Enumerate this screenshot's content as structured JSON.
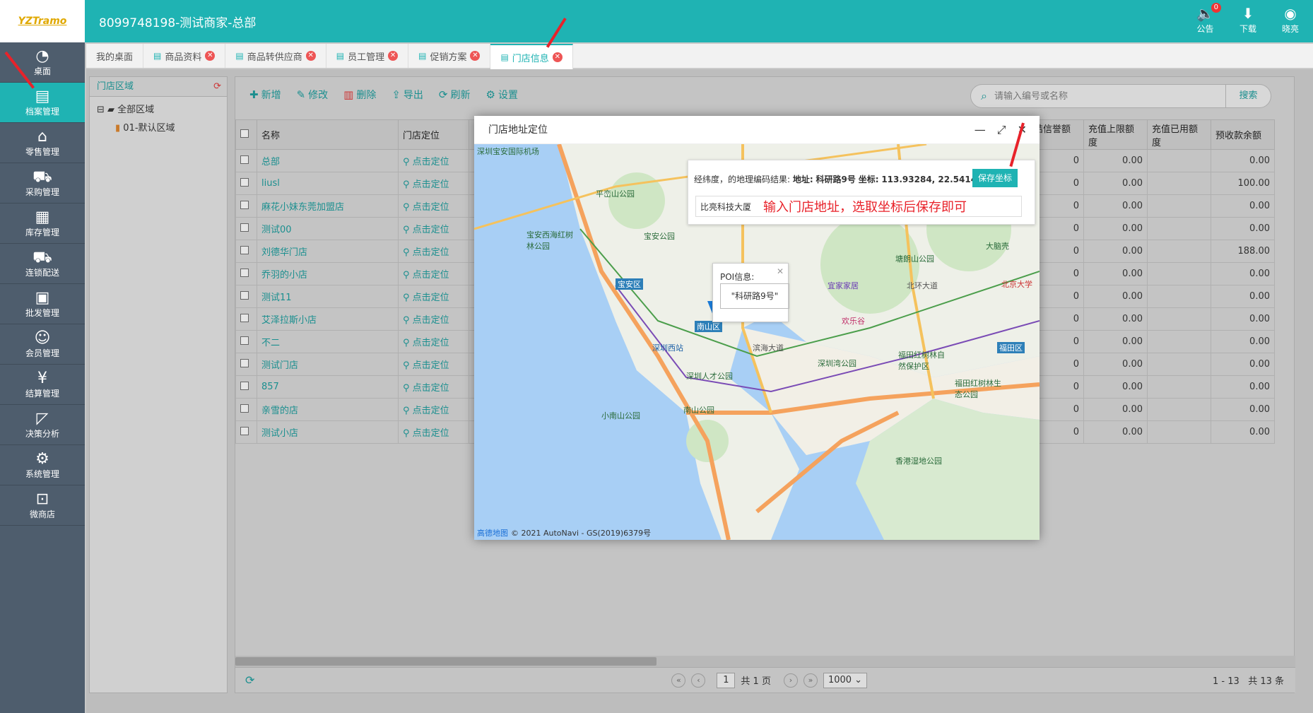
{
  "header": {
    "logo_text": "YZTramo",
    "title": "8099748198-测试商家-总部",
    "icons": [
      {
        "name": "announcement-icon",
        "label": "公告",
        "badge": "0"
      },
      {
        "name": "download-icon",
        "label": "下载"
      },
      {
        "name": "user-avatar-icon",
        "label": "晓亮"
      }
    ]
  },
  "sidebar": {
    "items": [
      {
        "label": "桌面",
        "icon": "dashboard-icon"
      },
      {
        "label": "档案管理",
        "icon": "archive-icon",
        "active": true
      },
      {
        "label": "零售管理",
        "icon": "store-icon"
      },
      {
        "label": "采购管理",
        "icon": "cart-icon"
      },
      {
        "label": "库存管理",
        "icon": "inventory-icon"
      },
      {
        "label": "连锁配送",
        "icon": "truck-icon"
      },
      {
        "label": "批发管理",
        "icon": "wholesale-icon"
      },
      {
        "label": "会员管理",
        "icon": "member-icon"
      },
      {
        "label": "结算管理",
        "icon": "settlement-icon"
      },
      {
        "label": "决策分析",
        "icon": "chart-icon"
      },
      {
        "label": "系统管理",
        "icon": "gear-icon"
      },
      {
        "label": "微商店",
        "icon": "shop-icon"
      }
    ]
  },
  "tabs": [
    {
      "label": "我的桌面",
      "closable": false
    },
    {
      "label": "商品资料",
      "closable": true
    },
    {
      "label": "商品转供应商",
      "closable": true
    },
    {
      "label": "员工管理",
      "closable": true
    },
    {
      "label": "促销方案",
      "closable": true
    },
    {
      "label": "门店信息",
      "closable": true,
      "active": true
    }
  ],
  "region": {
    "title": "门店区域",
    "root": "全部区域",
    "child": "01-默认区域"
  },
  "toolbar": {
    "add": "新增",
    "edit": "修改",
    "delete": "删除",
    "export": "导出",
    "refresh": "刷新",
    "settings": "设置",
    "search_placeholder": "请输入编号或名称",
    "search_button": "搜索"
  },
  "table": {
    "headers": [
      "名称",
      "门店定位"
    ],
    "right_headers": [
      "冻结信誉额度",
      "充值上限额度",
      "充值已用额度",
      "预收款余额"
    ],
    "rows": [
      {
        "name": "总部",
        "loc": "点击定位",
        "c1": "0",
        "c2": "0.00",
        "c3": "",
        "c4": "0.00"
      },
      {
        "name": "liusl",
        "loc": "点击定位",
        "c1": "0",
        "c2": "0.00",
        "c3": "",
        "c4": "100.00"
      },
      {
        "name": "麻花小妹东莞加盟店",
        "loc": "点击定位",
        "c1": "0",
        "c2": "0.00",
        "c3": "",
        "c4": "0.00"
      },
      {
        "name": "测试00",
        "loc": "点击定位",
        "c1": "0",
        "c2": "0.00",
        "c3": "",
        "c4": "0.00"
      },
      {
        "name": "刘德华门店",
        "loc": "点击定位",
        "c1": "0",
        "c2": "0.00",
        "c3": "",
        "c4": "188.00"
      },
      {
        "name": "乔羽的小店",
        "loc": "点击定位",
        "c1": "0",
        "c2": "0.00",
        "c3": "",
        "c4": "0.00"
      },
      {
        "name": "测试11",
        "loc": "点击定位",
        "c1": "0",
        "c2": "0.00",
        "c3": "",
        "c4": "0.00"
      },
      {
        "name": "艾泽拉斯小店",
        "loc": "点击定位",
        "c1": "0",
        "c2": "0.00",
        "c3": "",
        "c4": "0.00"
      },
      {
        "name": "不二",
        "loc": "点击定位",
        "c1": "0",
        "c2": "0.00",
        "c3": "",
        "c4": "0.00"
      },
      {
        "name": "测试门店",
        "loc": "点击定位",
        "c1": "0",
        "c2": "0.00",
        "c3": "",
        "c4": "0.00"
      },
      {
        "name": "857",
        "loc": "点击定位",
        "c1": "0",
        "c2": "0.00",
        "c3": "",
        "c4": "0.00"
      },
      {
        "name": "亲雪的店",
        "loc": "点击定位",
        "c1": "0",
        "c2": "0.00",
        "c3": "",
        "c4": "0.00"
      },
      {
        "name": "测试小店",
        "loc": "点击定位",
        "c1": "0",
        "c2": "0.00",
        "c3": "",
        "c4": "0.00"
      }
    ]
  },
  "pager": {
    "page": "1",
    "total": "共 1 页",
    "size": "1000",
    "range": "1 - 13",
    "count": "共 13 条"
  },
  "dialog": {
    "title": "门店地址定位",
    "geo_prefix": "经纬度，的地理编码结果: ",
    "addr_label": "地址:",
    "addr_value": "科研路9号",
    "coord_label": "坐标:",
    "coord_value": "113.93284, 22.541466",
    "save_button": "保存坐标",
    "input_value": "比亮科技大厦",
    "annotation": "输入门店地址，选取坐标后保存即可",
    "poi_label": "POI信息:",
    "poi_value": "\"科研路9号\"",
    "copyright": "© 2021 AutoNavi - GS(2019)6379号",
    "map_logo": "高德地图",
    "map_labels": [
      "深圳宝安国际机场",
      "平峦山公园",
      "宝安西海红树林公园",
      "宝安公园",
      "宝安区",
      "南山区",
      "深圳西站",
      "滨海大道",
      "深圳人才公园",
      "南山公园",
      "小南山公园",
      "塘朗山公园",
      "宜家家居",
      "欢乐谷",
      "北环大道",
      "大脑壳",
      "北京大学",
      "福田区",
      "福田红树林自然保护区",
      "深圳湾公园",
      "福田红树林生态公园",
      "香港湿地公园"
    ]
  }
}
